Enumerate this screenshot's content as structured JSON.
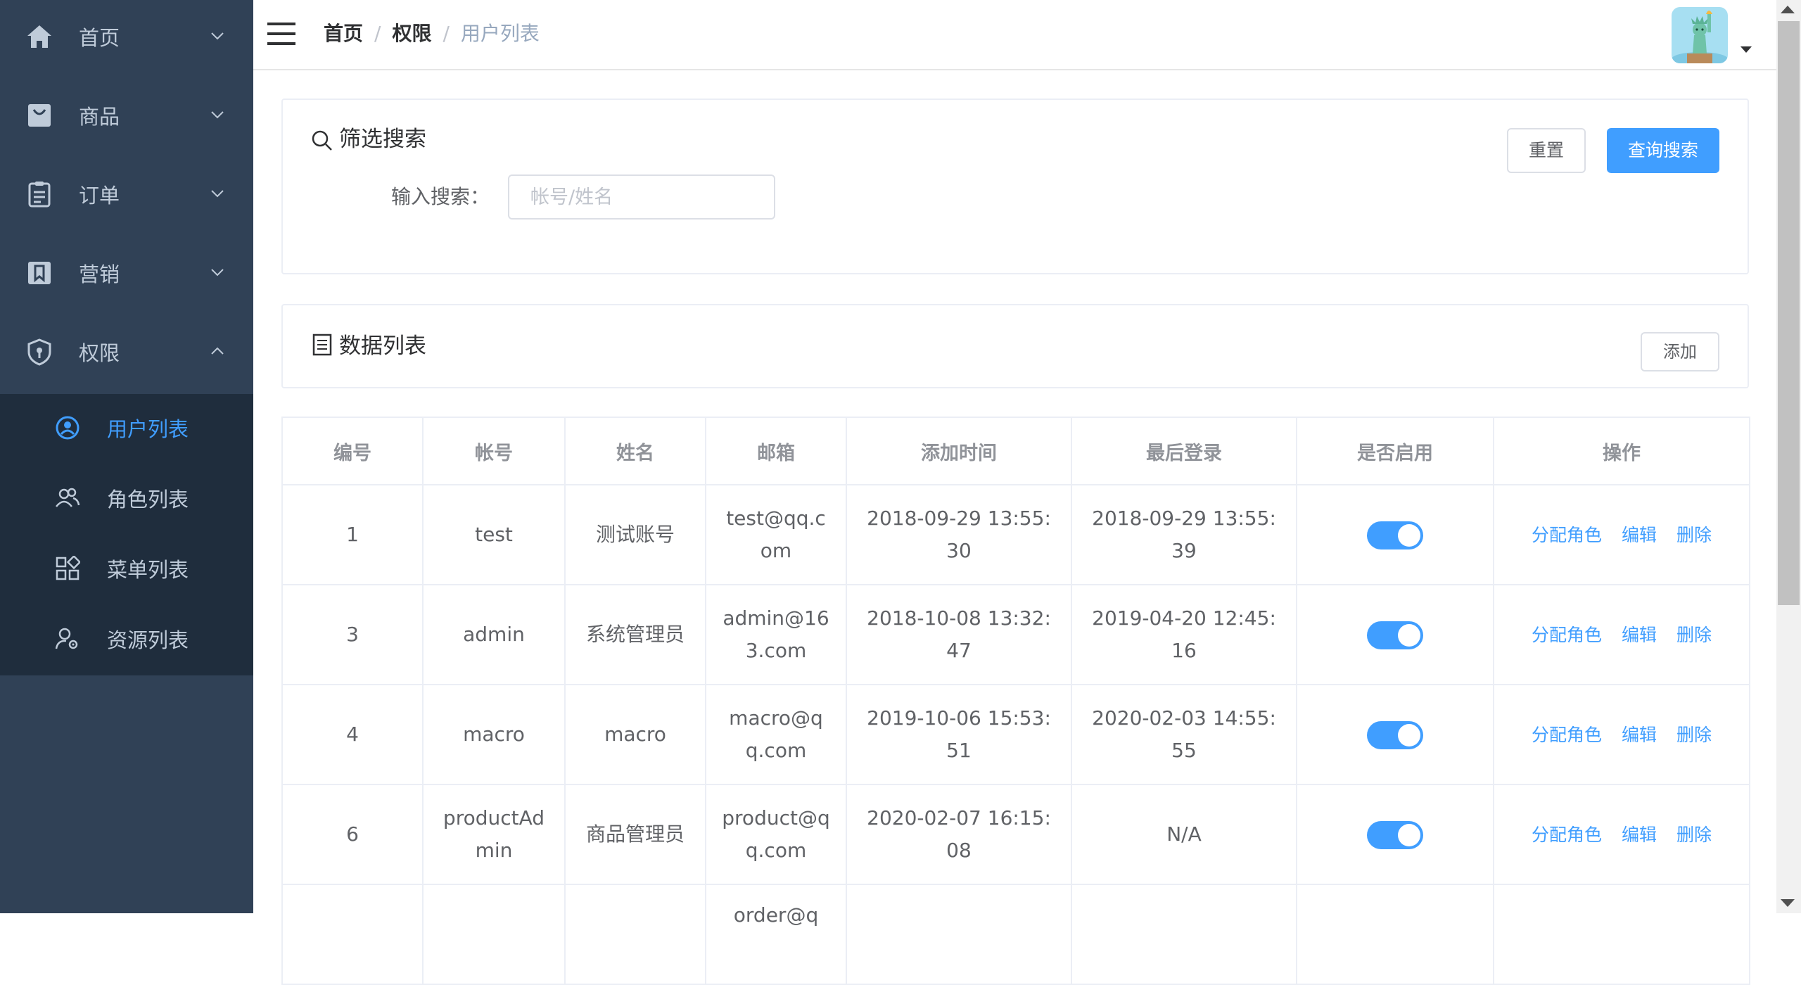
{
  "sidebar": {
    "menu": [
      {
        "label": "首页",
        "icon": "home-icon"
      },
      {
        "label": "商品",
        "icon": "shopping-bag-icon"
      },
      {
        "label": "订单",
        "icon": "clipboard-icon"
      },
      {
        "label": "营销",
        "icon": "bookmark-icon"
      },
      {
        "label": "权限",
        "icon": "shield-icon",
        "expanded": true
      }
    ],
    "submenu": [
      {
        "label": "用户列表",
        "icon": "user-circle-icon",
        "active": true
      },
      {
        "label": "角色列表",
        "icon": "users-icon"
      },
      {
        "label": "菜单列表",
        "icon": "grid-icon"
      },
      {
        "label": "资源列表",
        "icon": "user-gear-icon"
      }
    ],
    "colors": {
      "background": "#304156",
      "submenu_background": "#1f2d3d",
      "text": "#bfcbd9",
      "active": "#409eff"
    }
  },
  "navbar": {
    "breadcrumb": [
      "首页",
      "权限",
      "用户列表"
    ],
    "separator": "/"
  },
  "filter": {
    "title": "筛选搜索",
    "search_label": "输入搜索：",
    "search_placeholder": "帐号/姓名",
    "search_value": "",
    "reset_label": "重置",
    "query_label": "查询搜索"
  },
  "data_list": {
    "title": "数据列表",
    "add_label": "添加"
  },
  "table": {
    "columns": [
      "编号",
      "帐号",
      "姓名",
      "邮箱",
      "添加时间",
      "最后登录",
      "是否启用",
      "操作"
    ],
    "rows": [
      {
        "id": "1",
        "account": "test",
        "name": "测试账号",
        "email": "test@qq.com",
        "created": "2018-09-29 13:55:30",
        "last_login": "2018-09-29 13:55:39",
        "enabled": true
      },
      {
        "id": "3",
        "account": "admin",
        "name": "系统管理员",
        "email": "admin@163.com",
        "created": "2018-10-08 13:32:47",
        "last_login": "2019-04-20 12:45:16",
        "enabled": true
      },
      {
        "id": "4",
        "account": "macro",
        "name": "macro",
        "email": "macro@qq.com",
        "created": "2019-10-06 15:53:51",
        "last_login": "2020-02-03 14:55:55",
        "enabled": true
      },
      {
        "id": "6",
        "account": "productAdmin",
        "name": "商品管理员",
        "email": "product@qq.com",
        "created": "2020-02-07 16:15:08",
        "last_login": "N/A",
        "enabled": true
      },
      {
        "id": "",
        "account": "",
        "name": "",
        "email": "order@q",
        "created": "",
        "last_login": "",
        "enabled": true
      }
    ],
    "actions": [
      "分配角色",
      "编辑",
      "删除"
    ],
    "colors": {
      "switch_on": "#409eff",
      "link": "#409eff"
    }
  }
}
